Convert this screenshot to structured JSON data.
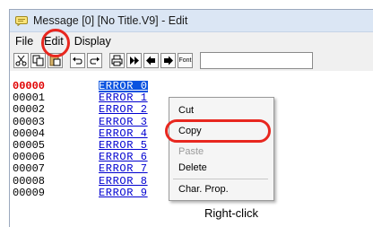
{
  "window": {
    "title": "Message [0] [No Title.V9] - Edit"
  },
  "menu": [
    "File",
    "Edit",
    "Display"
  ],
  "toolbar": {
    "buttons": [
      "cut-icon",
      "copy-icon",
      "paste-icon",
      "undo-icon",
      "redo-icon",
      "print-icon",
      "jump-icon",
      "left-arrow-icon",
      "right-arrow-icon"
    ],
    "font_label": "Font"
  },
  "list": {
    "addresses": [
      "00000",
      "00001",
      "00002",
      "00003",
      "00004",
      "00005",
      "00006",
      "00007",
      "00008",
      "00009"
    ],
    "values": [
      "ERROR 0",
      "ERROR 1",
      "ERROR 2",
      "ERROR 3",
      "ERROR 4",
      "ERROR 5",
      "ERROR 6",
      "ERROR 7",
      "ERROR 8",
      "ERROR 9"
    ],
    "selected_index": 0
  },
  "context_menu": {
    "items": [
      "Cut",
      "Copy",
      "Paste",
      "Delete",
      "Char. Prop."
    ],
    "disabled": [
      "Paste"
    ]
  },
  "annotation": {
    "text": "Right-click",
    "color": "#e8271f"
  }
}
